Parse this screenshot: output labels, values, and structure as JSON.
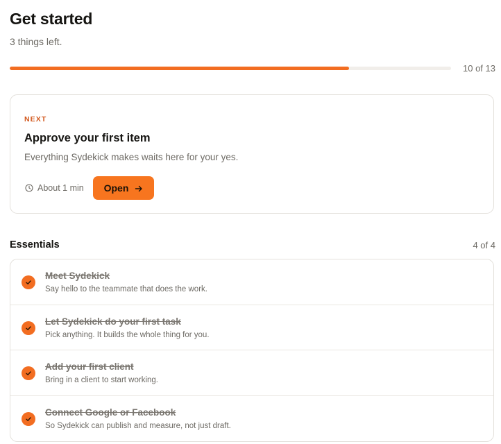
{
  "header": {
    "title": "Get started",
    "subtitle": "3 things left."
  },
  "progress": {
    "done": 10,
    "total": 13,
    "label": "10 of 13",
    "fraction": 0.769,
    "fill_color": "#f26d21"
  },
  "next_card": {
    "eyebrow": "NEXT",
    "title": "Approve your first item",
    "description": "Everything Sydekick makes waits here for your yes.",
    "duration": "About 1 min",
    "duration_icon": "clock-icon",
    "button_label": "Open",
    "button_icon": "arrow-right-icon",
    "accent": "#f7751f"
  },
  "essentials": {
    "title": "Essentials",
    "count": "4 of 4",
    "items": [
      {
        "title": "Meet Sydekick",
        "description": "Say hello to the teammate that does the work.",
        "done": true
      },
      {
        "title": "Let Sydekick do your first task",
        "description": "Pick anything. It builds the whole thing for you.",
        "done": true
      },
      {
        "title": "Add your first client",
        "description": "Bring in a client to start working.",
        "done": true
      },
      {
        "title": "Connect Google or Facebook",
        "description": "So Sydekick can publish and measure, not just draft.",
        "done": true
      }
    ]
  }
}
